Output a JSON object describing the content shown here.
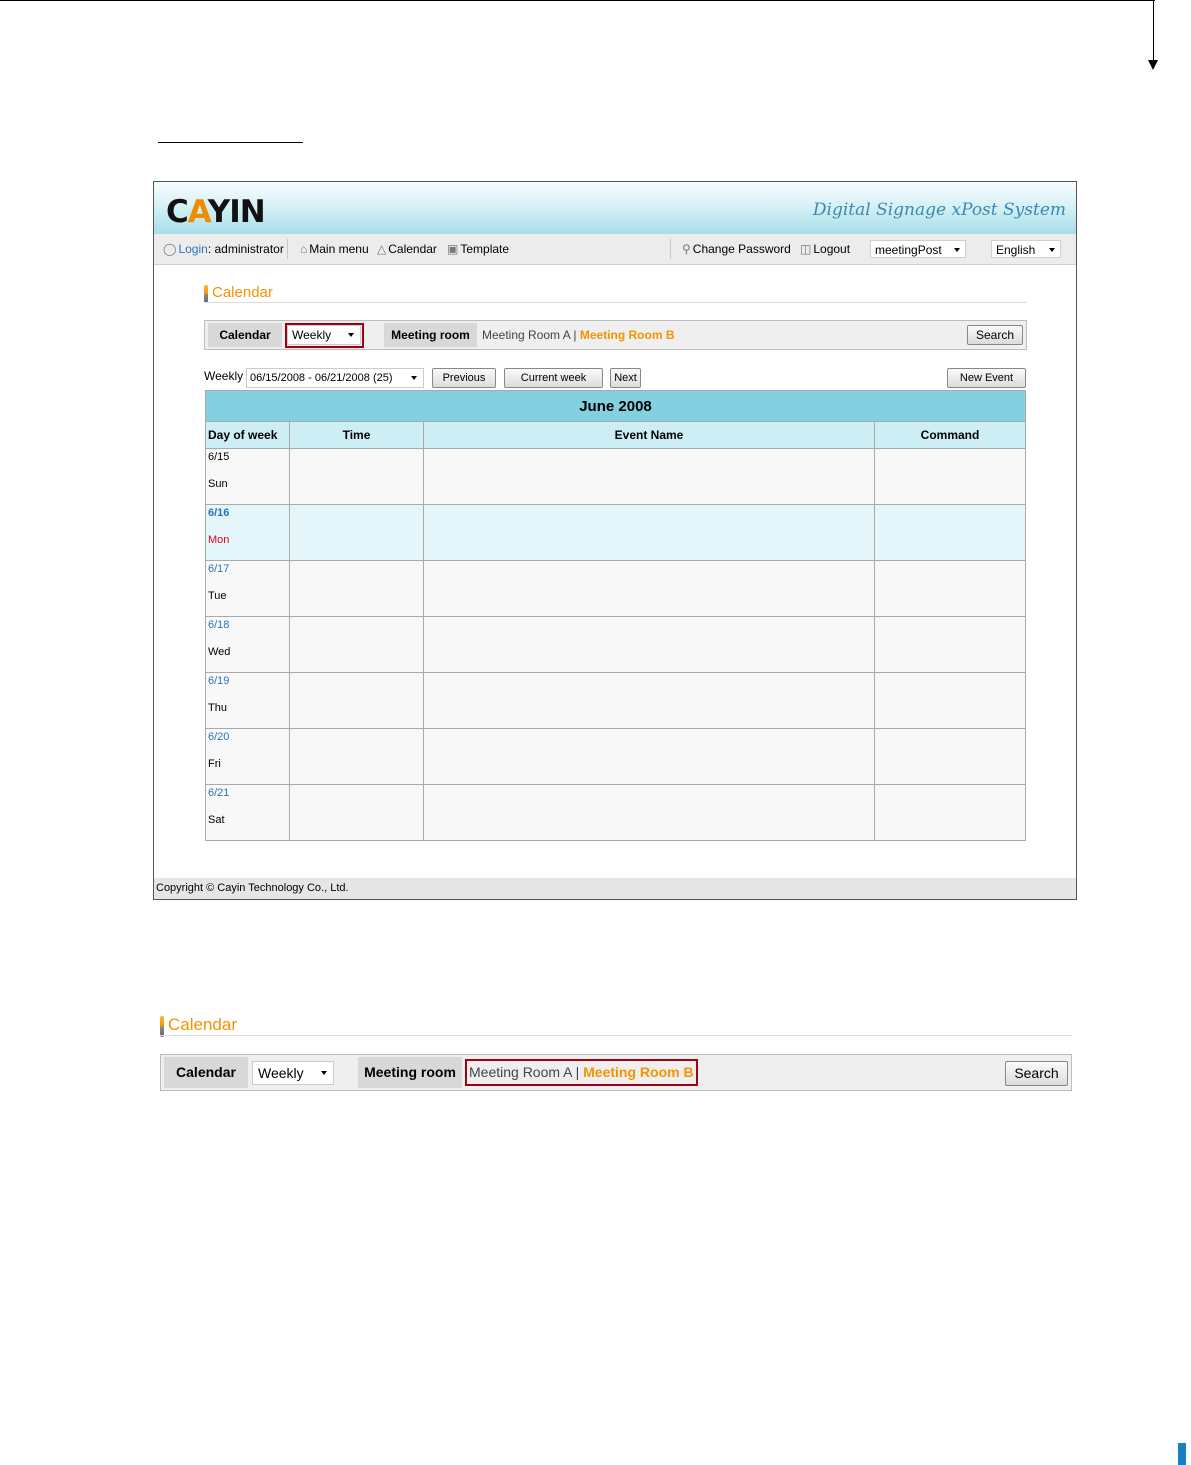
{
  "app": {
    "brand": "Digital Signage xPost System",
    "logo": {
      "c": "C",
      "a": "A",
      "y": "Y",
      "in": "IN"
    },
    "nav": {
      "login_label": "Login",
      "login_user": ": administrator",
      "main_menu": "Main menu",
      "calendar": "Calendar",
      "template": "Template",
      "change_password": "Change Password",
      "logout": "Logout",
      "server_select": "meetingPost",
      "language_select": "English"
    },
    "section_title": "Calendar",
    "filter": {
      "calendar_label": "Calendar",
      "view_select": "Weekly",
      "meeting_room_label": "Meeting room",
      "room_a": "Meeting Room A |",
      "room_b": "Meeting Room B",
      "search_button": "Search"
    },
    "weekbar": {
      "label": "Weekly",
      "range_select": "06/15/2008 - 06/21/2008 (25)",
      "previous": "Previous",
      "current_week": "Current week",
      "next": "Next",
      "new_event": "New Event"
    },
    "calendar": {
      "month": "June 2008",
      "columns": [
        "Day of week",
        "Time",
        "Event Name",
        "Command"
      ],
      "days": [
        {
          "date": "6/15",
          "day": "Sun"
        },
        {
          "date": "6/16",
          "day": "Mon"
        },
        {
          "date": "6/17",
          "day": "Tue"
        },
        {
          "date": "6/18",
          "day": "Wed"
        },
        {
          "date": "6/19",
          "day": "Thu"
        },
        {
          "date": "6/20",
          "day": "Fri"
        },
        {
          "date": "6/21",
          "day": "Sat"
        }
      ]
    },
    "footer": "Copyright © Cayin Technology Co., Ltd."
  },
  "zoom": {
    "section_title": "Calendar",
    "calendar_label": "Calendar",
    "view_select": "Weekly",
    "meeting_room_label": "Meeting room",
    "room_a": "Meeting Room A |",
    "room_b": "Meeting Room B",
    "search_button": "Search"
  },
  "colors": {
    "accent": "#f39400",
    "highlight": "#a00010",
    "table_header": "#83d0e0",
    "link": "#2d74b4"
  }
}
